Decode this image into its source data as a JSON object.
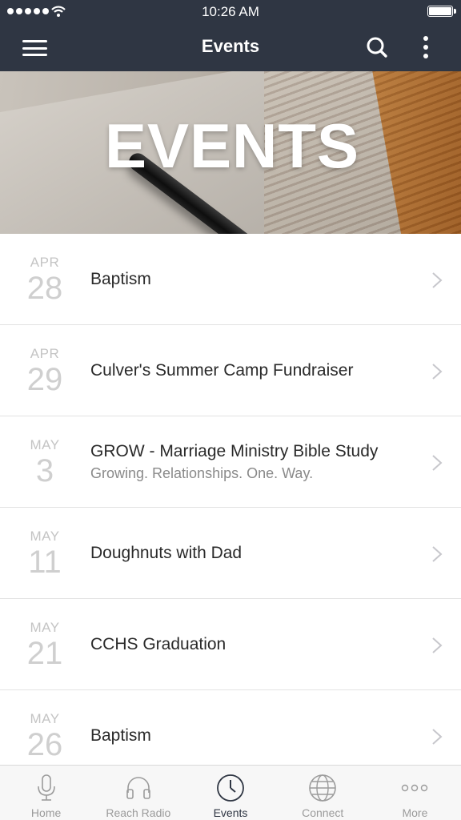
{
  "status_bar": {
    "time": "10:26 AM"
  },
  "nav": {
    "title": "Events"
  },
  "hero": {
    "title": "EVENTS"
  },
  "events": [
    {
      "month": "APR",
      "day": "28",
      "title": "Baptism",
      "subtitle": ""
    },
    {
      "month": "APR",
      "day": "29",
      "title": "Culver's Summer Camp Fundraiser",
      "subtitle": ""
    },
    {
      "month": "MAY",
      "day": "3",
      "title": "GROW - Marriage Ministry Bible Study",
      "subtitle": "Growing. Relationships. One. Way."
    },
    {
      "month": "MAY",
      "day": "11",
      "title": "Doughnuts with Dad",
      "subtitle": ""
    },
    {
      "month": "MAY",
      "day": "21",
      "title": "CCHS Graduation",
      "subtitle": ""
    },
    {
      "month": "MAY",
      "day": "26",
      "title": "Baptism",
      "subtitle": ""
    }
  ],
  "tabbar": {
    "items": [
      {
        "label": "Home",
        "icon": "microphone-icon"
      },
      {
        "label": "Reach Radio",
        "icon": "headphones-icon"
      },
      {
        "label": "Events",
        "icon": "clock-icon",
        "active": true
      },
      {
        "label": "Connect",
        "icon": "globe-icon"
      },
      {
        "label": "More",
        "icon": "more-dots-icon"
      }
    ]
  },
  "colors": {
    "nav_background": "#2f3643",
    "active_tab": "#2f3643",
    "inactive_tab": "#9b9b9b"
  }
}
